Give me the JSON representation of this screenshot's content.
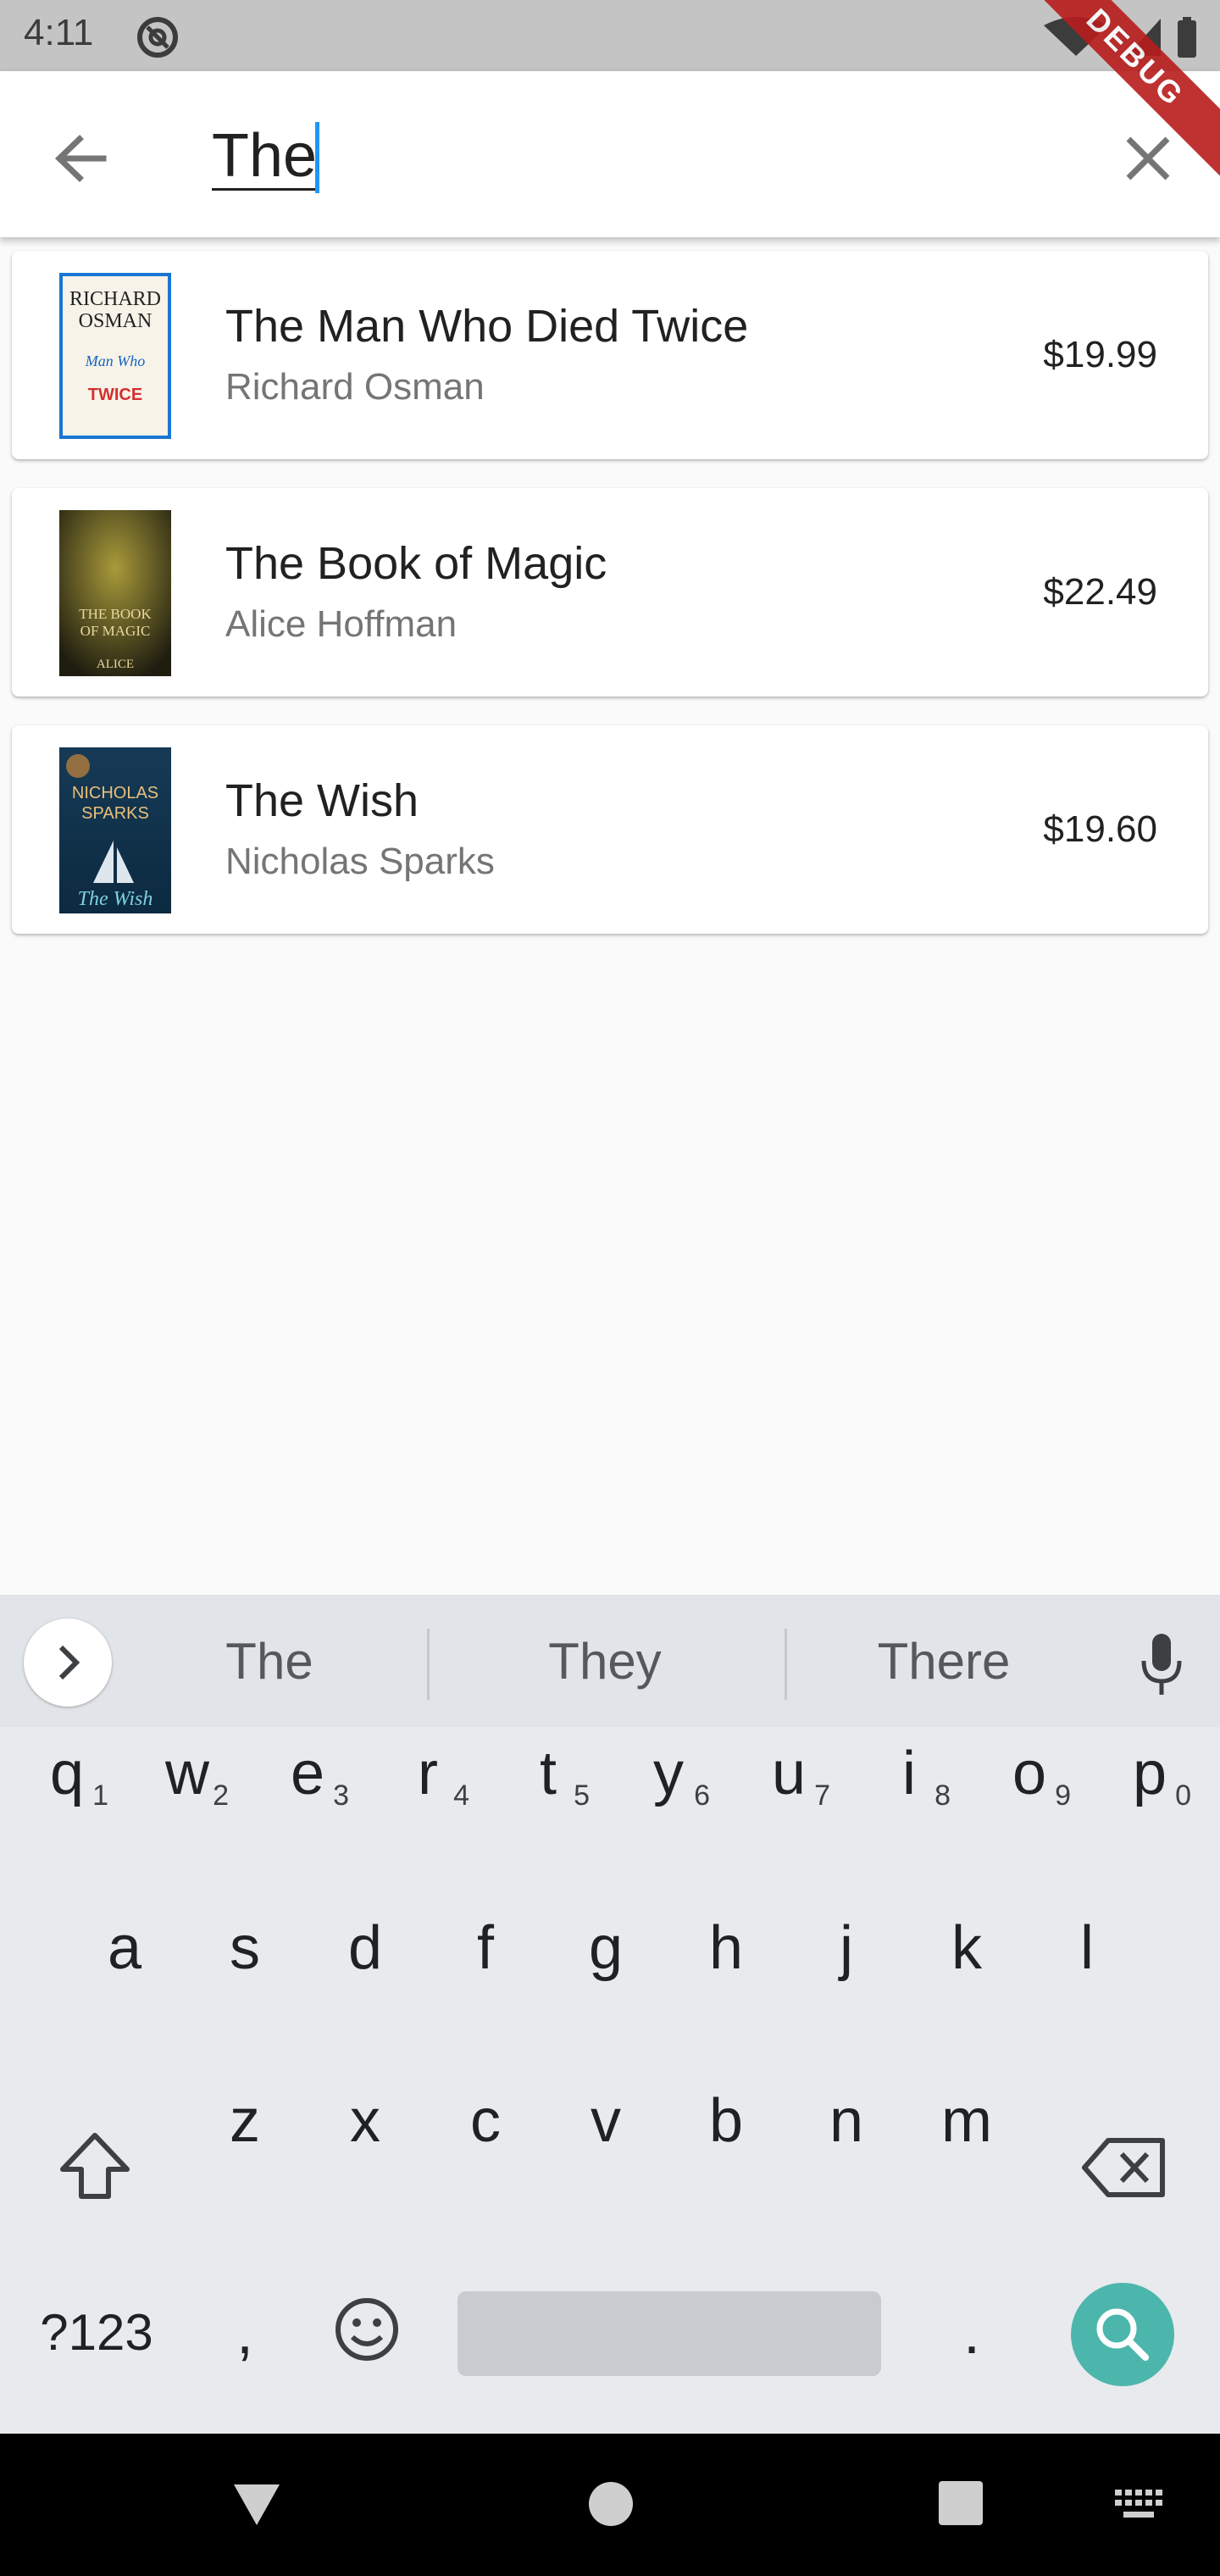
{
  "status_bar": {
    "time": "4:11"
  },
  "debug_banner": "DEBUG",
  "search": {
    "query": "The"
  },
  "results": [
    {
      "title": "The Man Who Died Twice",
      "author": "Richard Osman",
      "price": "$19.99",
      "cover_text": [
        "RICHARD",
        "OSMAN",
        "The Man Who Died TWICE"
      ]
    },
    {
      "title": "The Book of Magic",
      "author": "Alice Hoffman",
      "price": "$22.49",
      "cover_text": [
        "THE BOOK",
        "OF MAGIC",
        "ALICE HOFFMAN"
      ]
    },
    {
      "title": "The Wish",
      "author": "Nicholas Sparks",
      "price": "$19.60",
      "cover_text": [
        "NICHOLAS",
        "SPARKS",
        "The Wish"
      ]
    }
  ],
  "keyboard": {
    "suggestions": [
      "The",
      "They",
      "There"
    ],
    "row1": [
      "q",
      "w",
      "e",
      "r",
      "t",
      "y",
      "u",
      "i",
      "o",
      "p"
    ],
    "row1_nums": [
      "1",
      "2",
      "3",
      "4",
      "5",
      "6",
      "7",
      "8",
      "9",
      "0"
    ],
    "row2": [
      "a",
      "s",
      "d",
      "f",
      "g",
      "h",
      "j",
      "k",
      "l"
    ],
    "row3": [
      "z",
      "x",
      "c",
      "v",
      "b",
      "n",
      "m"
    ],
    "symbols_label": "?123",
    "comma": ",",
    "period": "."
  },
  "colors": {
    "accent": "#2196f3",
    "search_key": "#4db6ac",
    "debug": "#b71c1c"
  }
}
